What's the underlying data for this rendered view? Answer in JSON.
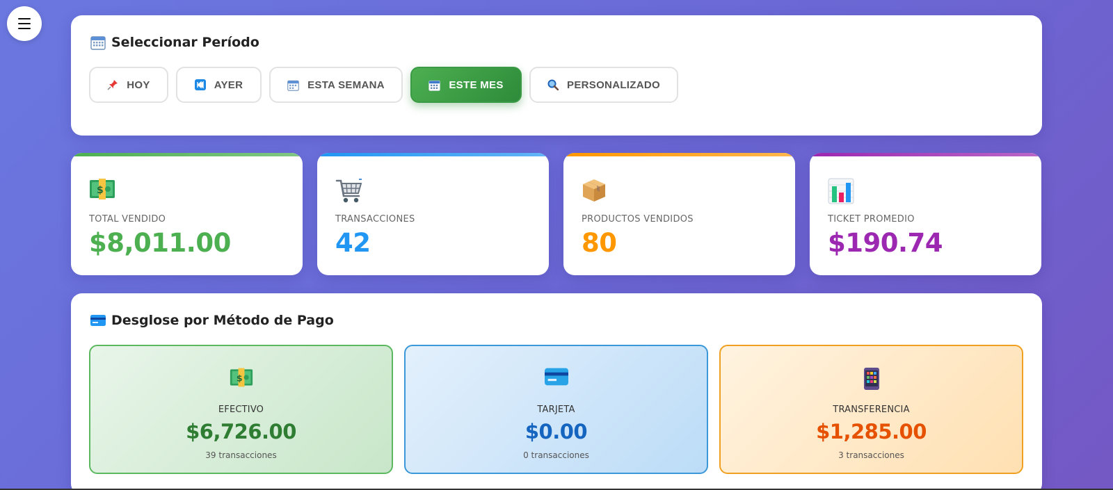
{
  "menu": {
    "icon": "hamburger-menu-icon"
  },
  "period": {
    "title": "Seleccionar Período",
    "title_icon": "calendar-icon",
    "buttons": [
      {
        "label": "HOY",
        "icon": "pushpin-icon",
        "active": false
      },
      {
        "label": "AYER",
        "icon": "rewind-icon",
        "active": false
      },
      {
        "label": "ESTA SEMANA",
        "icon": "calendar-icon",
        "active": false
      },
      {
        "label": "ESTE MES",
        "icon": "calendar-icon",
        "active": true
      },
      {
        "label": "PERSONALIZADO",
        "icon": "magnifier-icon",
        "active": false
      }
    ]
  },
  "stats": [
    {
      "label": "TOTAL VENDIDO",
      "value": "$8,011.00",
      "icon": "money-icon",
      "color": "#4caf50"
    },
    {
      "label": "TRANSACCIONES",
      "value": "42",
      "icon": "shopping-cart-icon",
      "color": "#2196f3"
    },
    {
      "label": "PRODUCTOS VENDIDOS",
      "value": "80",
      "icon": "package-icon",
      "color": "#ff9800"
    },
    {
      "label": "TICKET PROMEDIO",
      "value": "$190.74",
      "icon": "bar-chart-icon",
      "color": "#9c27b0"
    }
  ],
  "payments": {
    "title": "Desglose por Método de Pago",
    "title_icon": "credit-card-icon",
    "methods": [
      {
        "label": "EFECTIVO",
        "amount": "$6,726.00",
        "count": "39 transacciones",
        "icon": "money-icon",
        "color": "#2e7d32"
      },
      {
        "label": "TARJETA",
        "amount": "$0.00",
        "count": "0 transacciones",
        "icon": "credit-card-icon",
        "color": "#1565c0"
      },
      {
        "label": "TRANSFERENCIA",
        "amount": "$1,285.00",
        "count": "3 transacciones",
        "icon": "mobile-phone-icon",
        "color": "#e65100"
      }
    ]
  },
  "colors": {
    "accent_green": "#43a047",
    "bg_gradient_start": "#6b78e0",
    "bg_gradient_end": "#7458c4"
  }
}
